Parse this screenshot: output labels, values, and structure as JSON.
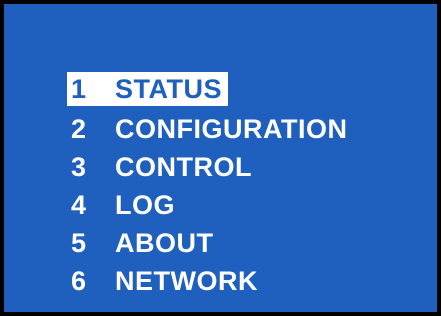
{
  "menu": {
    "selected_index": 0,
    "items": [
      {
        "number": "1",
        "label": "STATUS"
      },
      {
        "number": "2",
        "label": "CONFIGURATION"
      },
      {
        "number": "3",
        "label": "CONTROL"
      },
      {
        "number": "4",
        "label": "LOG"
      },
      {
        "number": "5",
        "label": "ABOUT"
      },
      {
        "number": "6",
        "label": "NETWORK"
      }
    ]
  },
  "colors": {
    "background": "#1f5fbe",
    "text": "#ffffff",
    "highlight": "#ffffff",
    "frame": "#000000"
  }
}
